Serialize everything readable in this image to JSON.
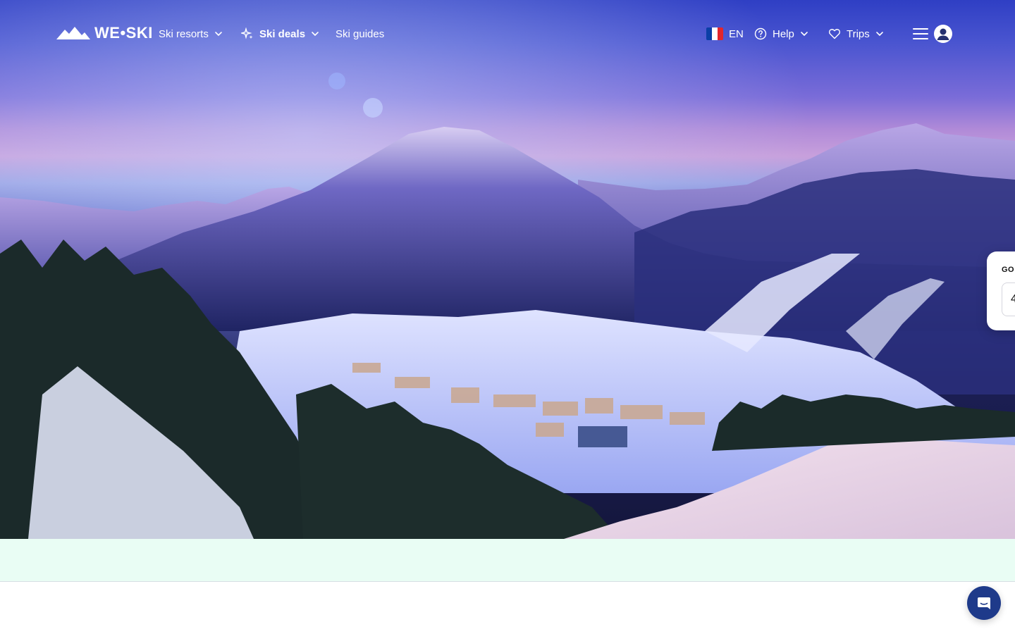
{
  "brand": {
    "name": "WE•SKI",
    "logo_icon": "mountain-logo-icon"
  },
  "nav": {
    "ski_resorts": "Ski resorts",
    "ski_deals": "Ski deals",
    "ski_guides": "Ski guides",
    "language": "EN",
    "help": "Help",
    "trips": "Trips"
  },
  "search_card": {
    "label": "GO",
    "field_value": "4"
  },
  "colors": {
    "nav_text": "#ffffff",
    "band": "#e9fdf4",
    "chat_button": "#1e3a8a",
    "flag_blue": "#0a3fa6",
    "flag_white": "#ffffff",
    "flag_red": "#e3262b"
  },
  "icons": [
    "mountain-logo-icon",
    "sparkle-icon",
    "chevron-down-icon",
    "flag-fr-icon",
    "help-circle-icon",
    "heart-icon",
    "hamburger-menu-icon",
    "user-avatar-icon",
    "chat-icon"
  ]
}
